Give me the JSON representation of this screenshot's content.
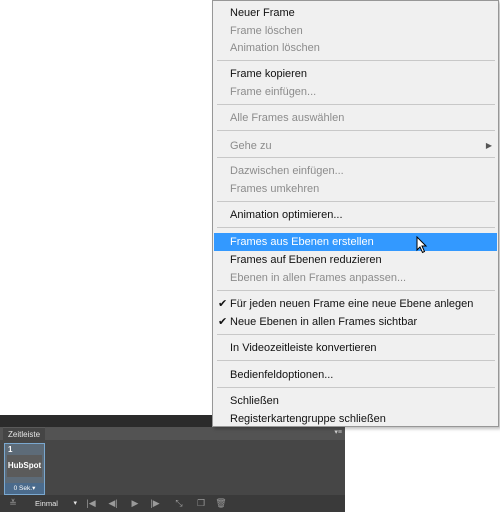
{
  "menu": {
    "items": [
      {
        "label": "Neuer Frame",
        "enabled": true
      },
      {
        "label": "Frame löschen",
        "enabled": false
      },
      {
        "label": "Animation löschen",
        "enabled": false
      },
      {
        "label": "Frame kopieren",
        "enabled": true
      },
      {
        "label": "Frame einfügen...",
        "enabled": false
      },
      {
        "label": "Alle Frames auswählen",
        "enabled": false
      },
      {
        "label": "Gehe zu",
        "enabled": false,
        "submenu": true
      },
      {
        "label": "Dazwischen einfügen...",
        "enabled": false
      },
      {
        "label": "Frames umkehren",
        "enabled": false
      },
      {
        "label": "Animation optimieren...",
        "enabled": true
      },
      {
        "label": "Frames aus Ebenen erstellen",
        "enabled": true,
        "highlighted": true
      },
      {
        "label": "Frames auf Ebenen reduzieren",
        "enabled": true
      },
      {
        "label": "Ebenen in allen Frames anpassen...",
        "enabled": false
      },
      {
        "label": "Für jeden neuen Frame eine neue Ebene anlegen",
        "enabled": true,
        "checked": true
      },
      {
        "label": "Neue Ebenen in allen Frames sichtbar",
        "enabled": true,
        "checked": true
      },
      {
        "label": "In Videozeitleiste konvertieren",
        "enabled": true
      },
      {
        "label": "Bedienfeldoptionen...",
        "enabled": true
      },
      {
        "label": "Schließen",
        "enabled": true
      },
      {
        "label": "Registerkartengruppe schließen",
        "enabled": true
      }
    ],
    "check_glyph": "✔",
    "submenu_glyph": "▶"
  },
  "panel": {
    "tab_label": "Zeitleiste",
    "menu_glyph": "▾≡",
    "frame": {
      "number": "1",
      "thumbnail_text": "HubSpot",
      "delay": "0 Sek.▾"
    },
    "loop_option": "Einmal",
    "loop_arrow": "▾",
    "toolbar_icons": [
      {
        "name": "convert-icon",
        "glyph": "≚"
      },
      {
        "name": "first-frame-icon",
        "glyph": "|◀"
      },
      {
        "name": "previous-frame-icon",
        "glyph": "◀|"
      },
      {
        "name": "play-icon",
        "glyph": "▶"
      },
      {
        "name": "next-frame-icon",
        "glyph": "|▶"
      },
      {
        "name": "tween-icon",
        "glyph": "⤡"
      },
      {
        "name": "duplicate-frame-icon",
        "glyph": "❐"
      },
      {
        "name": "delete-frame-icon",
        "glyph": "🗑"
      }
    ]
  },
  "colors": {
    "menu_bg": "#f0f0f0",
    "highlight": "#3399ff",
    "panel_bg": "#535353",
    "disabled_text": "#8c8c8c"
  }
}
